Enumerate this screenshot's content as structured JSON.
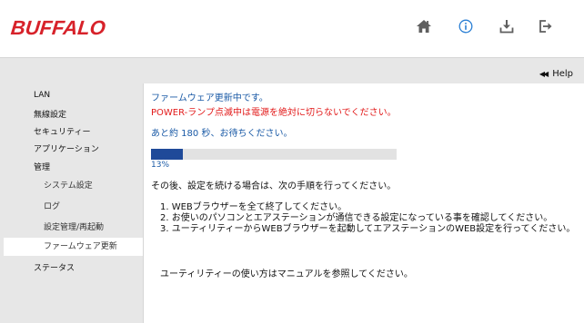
{
  "header": {
    "logo": "BUFFALO",
    "icons": [
      "home-icon",
      "info-icon",
      "download-icon",
      "logout-icon"
    ]
  },
  "help": {
    "label": "Help"
  },
  "sidebar": {
    "items": [
      {
        "label": "LAN"
      },
      {
        "label": "無線設定"
      },
      {
        "label": "セキュリティー"
      },
      {
        "label": "アプリケーション"
      },
      {
        "label": "管理"
      },
      {
        "label": "システム設定"
      },
      {
        "label": "ログ"
      },
      {
        "label": "設定管理/再起動"
      },
      {
        "label": "ファームウェア更新"
      },
      {
        "label": "ステータス"
      }
    ]
  },
  "main": {
    "updating": "ファームウェア更新中です。",
    "warning": "POWER-ランプ点滅中は電源を絶対に切らないでください。",
    "wait": "あと約 180 秒、お待ちください。",
    "progress": {
      "value": 0.13,
      "label": "13%"
    },
    "after": "その後、設定を続ける場合は、次の手順を行ってください。",
    "steps": [
      "1. WEBブラウザーを全て終了してください。",
      "2. お使いのパソコンとエアステーションが通信できる設定になっている事を確認してください。",
      "3. ユーティリティーからWEBブラウザーを起動してエアステーションのWEB設定を行ってください。"
    ],
    "manual": "ユーティリティーの使い方はマニュアルを参照してください。"
  },
  "colors": {
    "brand": "#d7222a",
    "accent": "#1a5aa6",
    "warning": "#e21a1a",
    "progress": "#1f4a99"
  }
}
